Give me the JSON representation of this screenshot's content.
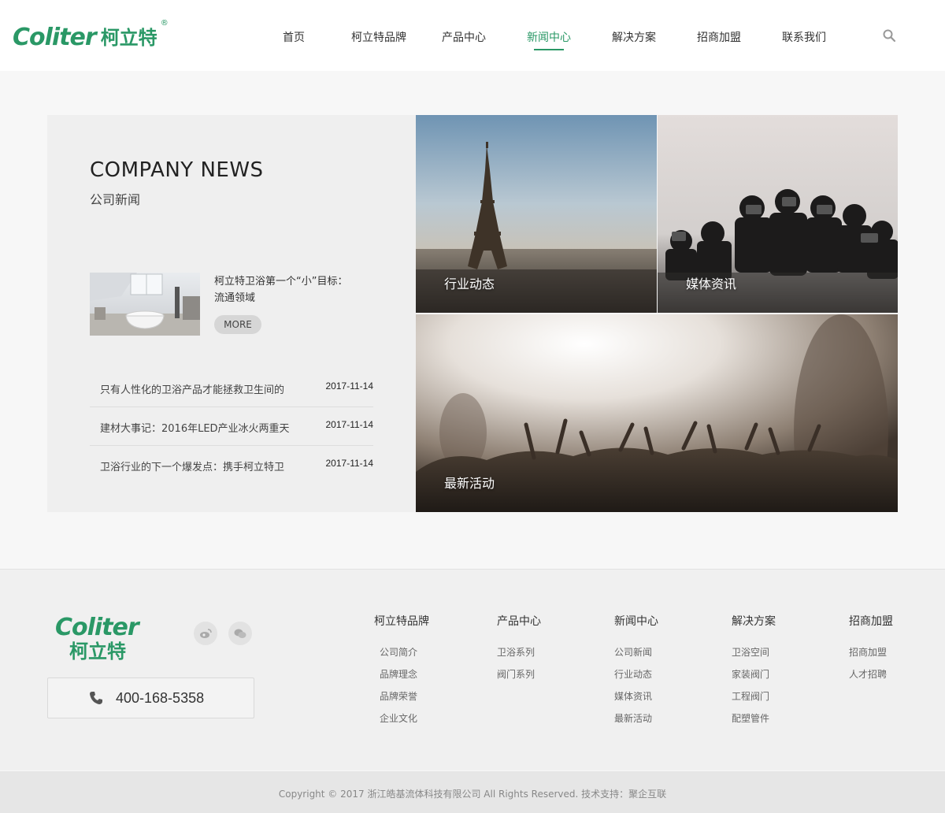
{
  "brand": {
    "logo_en": "Coliter",
    "logo_cn": "柯立特",
    "logo_reg": "®",
    "color": "#2a9866"
  },
  "nav": {
    "items": [
      {
        "label": "首页"
      },
      {
        "label": "柯立特品牌"
      },
      {
        "label": "产品中心"
      },
      {
        "label": "新闻中心"
      },
      {
        "label": "解决方案"
      },
      {
        "label": "招商加盟"
      },
      {
        "label": "联系我们"
      }
    ],
    "active": "新闻中心",
    "search_icon": "search-icon"
  },
  "news": {
    "title_en": "COMPANY NEWS",
    "title_cn": "公司新闻",
    "feature": {
      "title": "柯立特卫浴第一个“小”目标：流通领域",
      "more_label": "MORE"
    },
    "list": [
      {
        "title": "只有人性化的卫浴产品才能拯救卫生间的",
        "date": "2017-11-14"
      },
      {
        "title": "建材大事记：2016年LED产业冰火两重天",
        "date": "2017-11-14"
      },
      {
        "title": "卫浴行业的下一个爆发点：携手柯立特卫",
        "date": "2017-11-14"
      }
    ]
  },
  "tiles": {
    "industry": "行业动态",
    "media": "媒体资讯",
    "events": "最新活动"
  },
  "footer": {
    "logo_en": "Coliter",
    "logo_cn": "柯立特",
    "social": [
      "weibo-icon",
      "wechat-icon"
    ],
    "phone": "400-168-5358",
    "columns": [
      {
        "title": "柯立特品牌",
        "links": [
          "公司简介",
          "品牌理念",
          "品牌荣誉",
          "企业文化"
        ]
      },
      {
        "title": "产品中心",
        "links": [
          "卫浴系列",
          "阀门系列"
        ]
      },
      {
        "title": "新闻中心",
        "links": [
          "公司新闻",
          "行业动态",
          "媒体资讯",
          "最新活动"
        ]
      },
      {
        "title": "解决方案",
        "links": [
          "卫浴空间",
          "家装阀门",
          "工程阀门",
          "配塑管件"
        ]
      },
      {
        "title": "招商加盟",
        "links": [
          "招商加盟",
          "人才招聘"
        ]
      }
    ],
    "copyright": "Copyright © 2017 浙江皓基流体科技有限公司 All Rights Reserved. 技术支持：聚企互联"
  }
}
